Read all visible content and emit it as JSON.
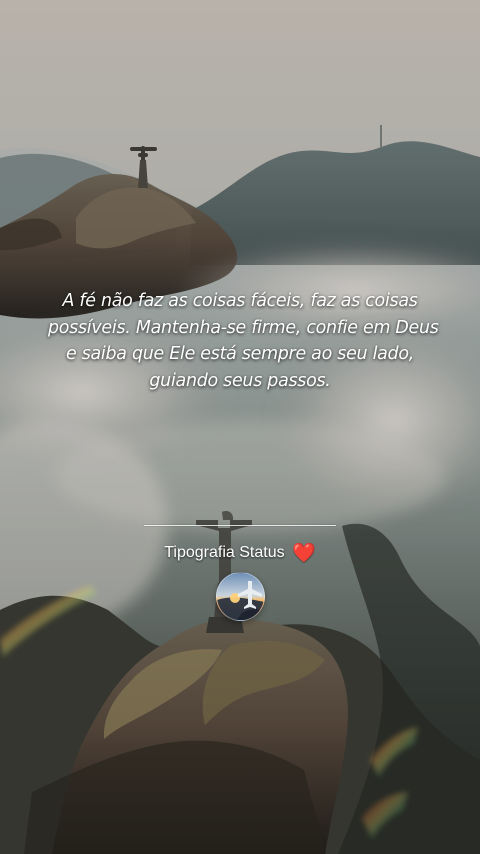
{
  "quote": {
    "lines": [
      "A fé não faz as coisas fáceis, faz as coisas",
      "possíveis. Mantenha-se firme, confie em Deus",
      "e saiba que Ele está sempre ao seu lado,",
      "guiando seus passos."
    ]
  },
  "attribution": {
    "label": "Tipografia Status",
    "heart": "❤️"
  },
  "icons": {
    "heart": "heart-icon",
    "avatar": "airplane-sunset-avatar"
  },
  "colors": {
    "text": "#ffffff",
    "heart": "#e02331"
  }
}
